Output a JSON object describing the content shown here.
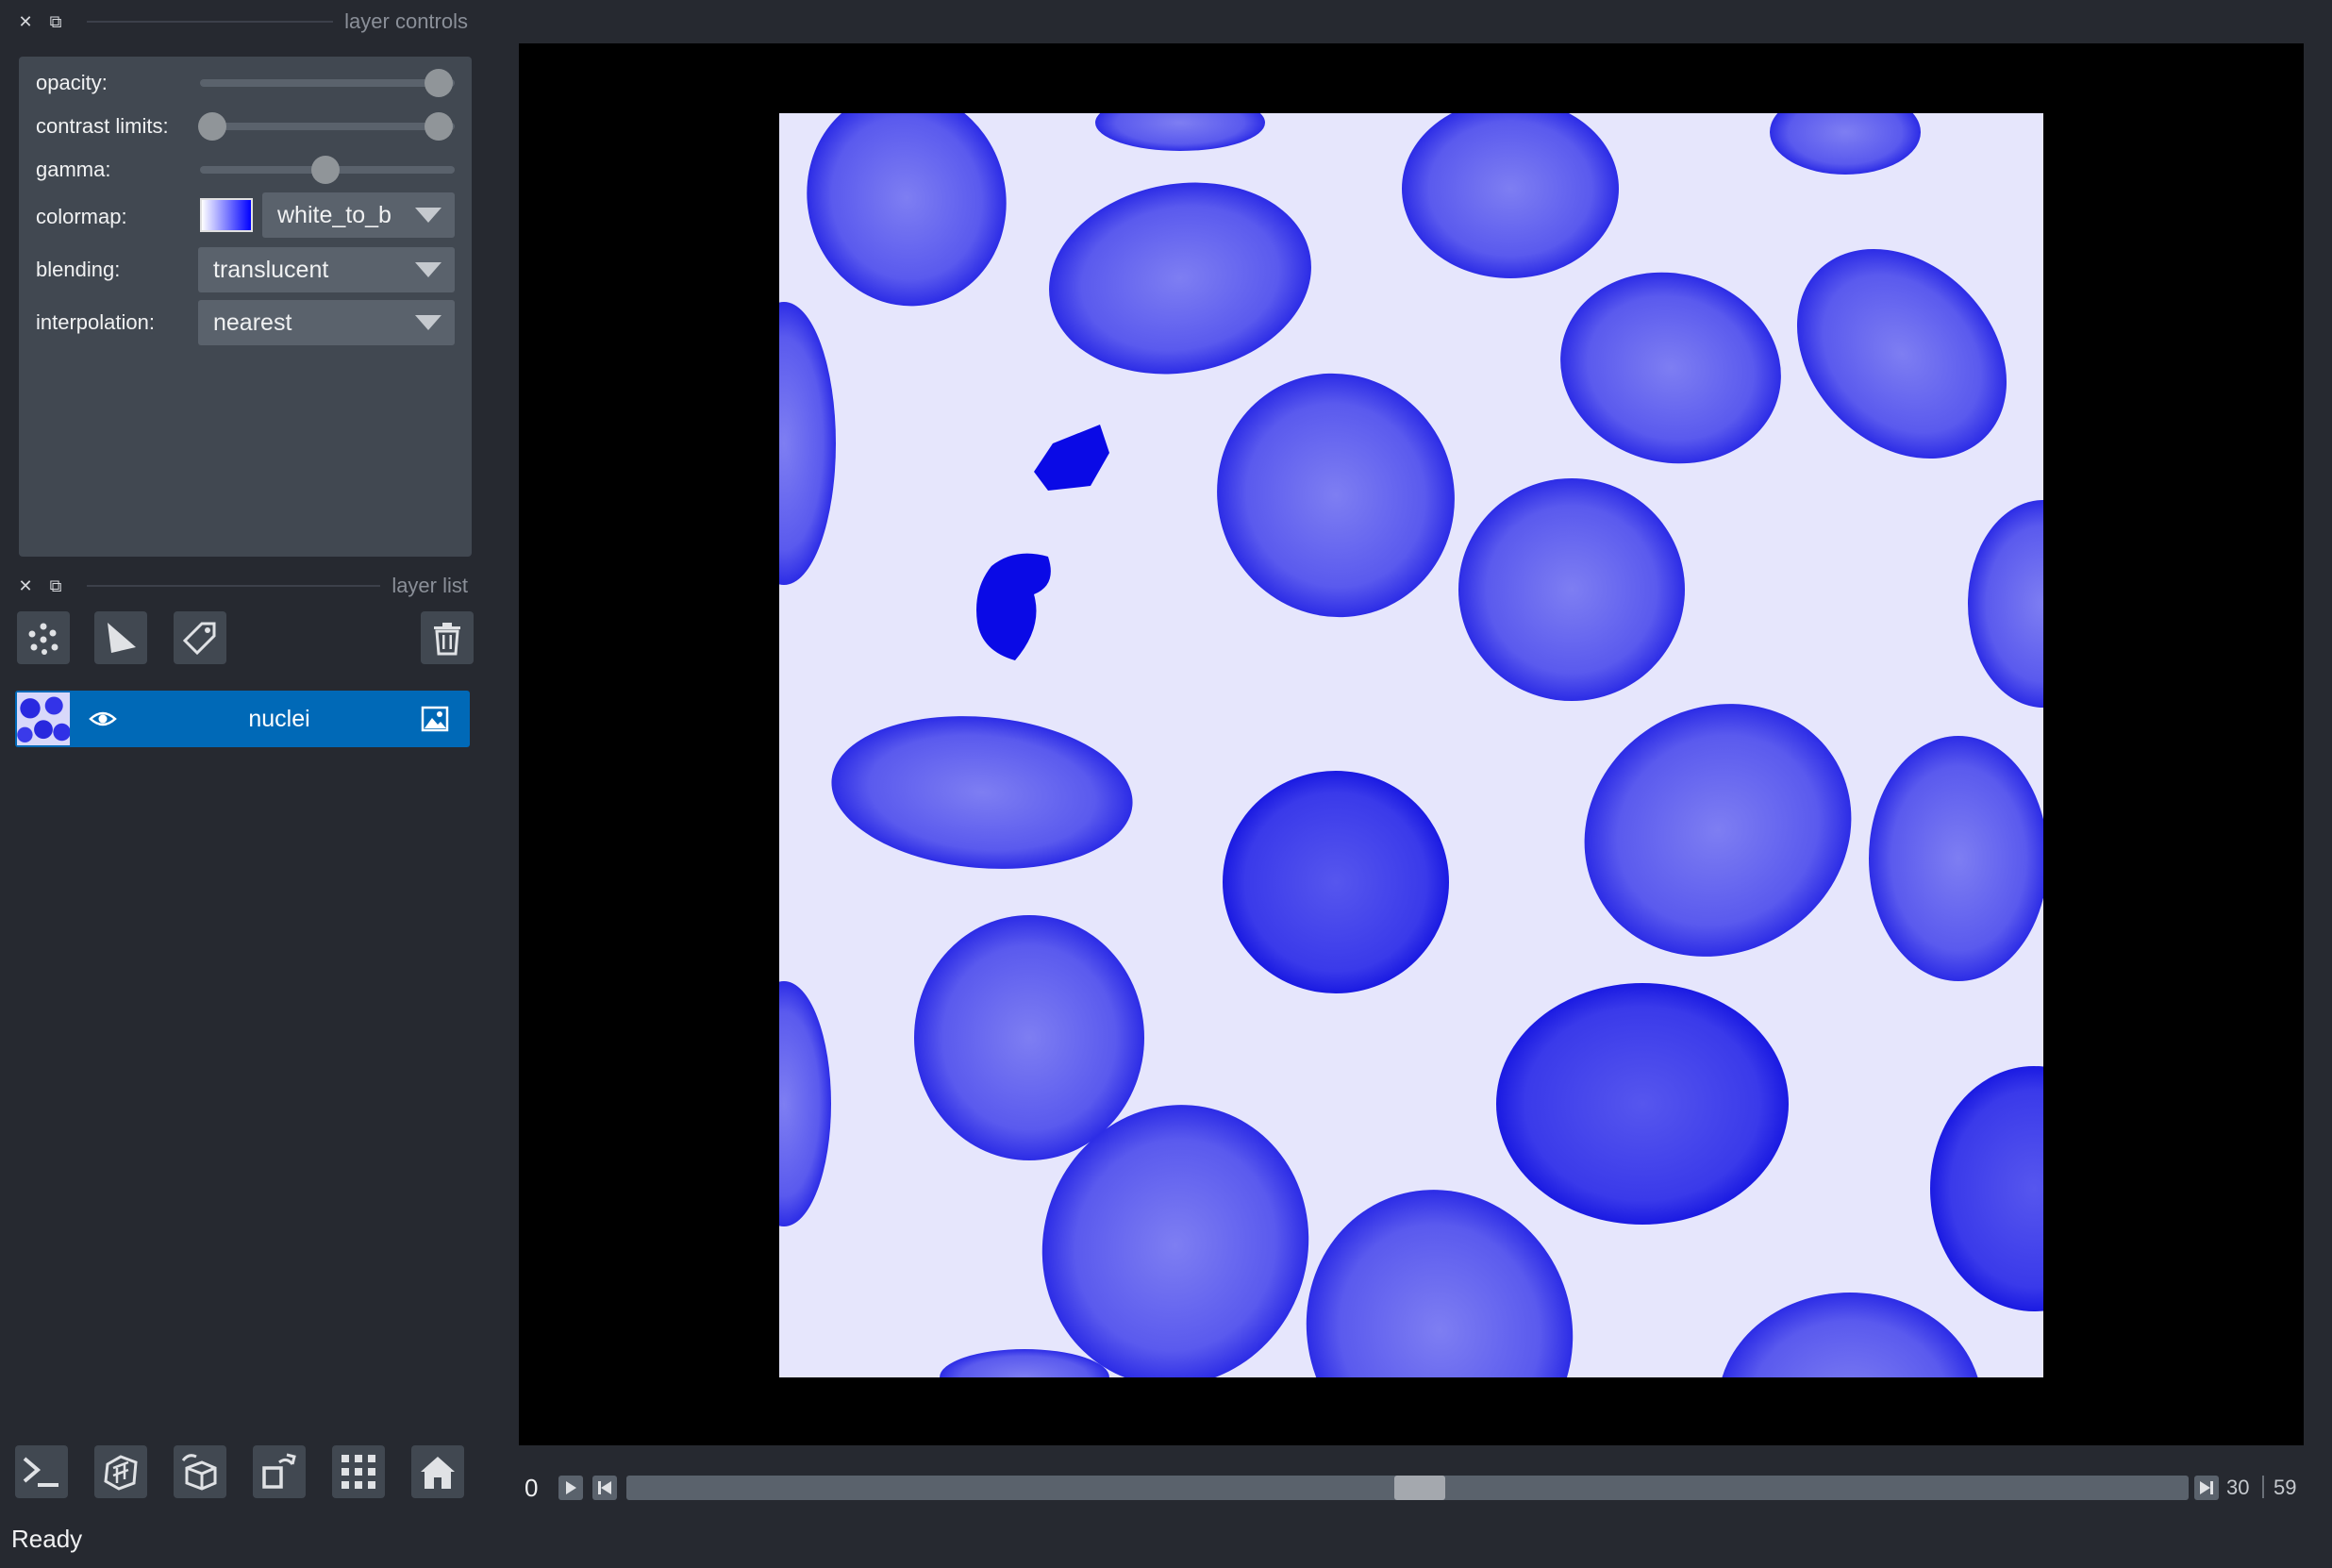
{
  "layer_controls": {
    "title": "layer controls",
    "opacity_label": "opacity:",
    "opacity_value": 1.0,
    "contrast_label": "contrast limits:",
    "contrast_range": [
      0.0,
      1.0
    ],
    "gamma_label": "gamma:",
    "gamma_value": 0.5,
    "colormap_label": "colormap:",
    "colormap_value": "white_to_b",
    "blending_label": "blending:",
    "blending_value": "translucent",
    "interpolation_label": "interpolation:",
    "interpolation_value": "nearest"
  },
  "layer_list": {
    "title": "layer list",
    "layers": [
      {
        "name": "nuclei",
        "visible": true,
        "type": "image"
      }
    ]
  },
  "dims": {
    "axis_label": "0",
    "current": "30",
    "max": "59",
    "position_fraction": 0.5
  },
  "status": "Ready",
  "colors": {
    "background": "#262930",
    "panel": "#414851",
    "selected_layer": "#0069b7",
    "colormap_end": "#0000ff"
  },
  "icons": {
    "new_points": "points-icon",
    "new_shapes": "shapes-icon",
    "new_labels": "labels-icon",
    "delete": "trash-icon",
    "console": "console-icon",
    "ndisplay": "cube-icon",
    "roll": "roll-icon",
    "transpose": "transpose-icon",
    "grid": "grid-icon",
    "home": "home-icon"
  }
}
